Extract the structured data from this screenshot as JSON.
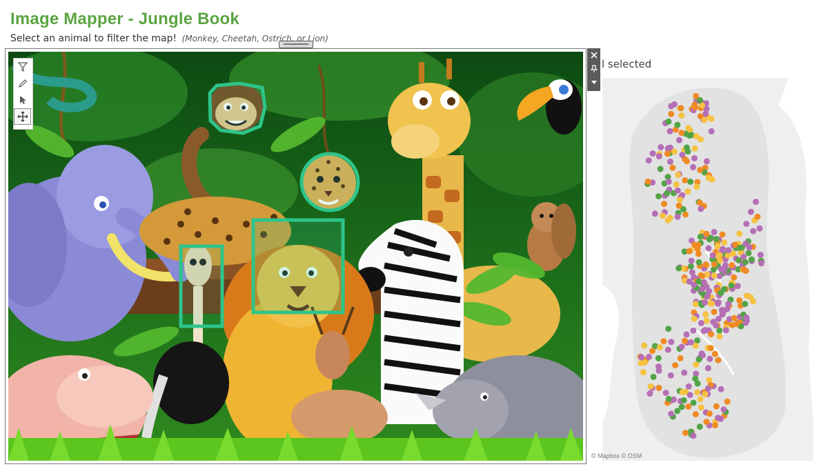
{
  "header": {
    "title": "Image Mapper - Jungle Book",
    "subtitle": "Select an animal to filter the map!",
    "hint": "(Monkey, Cheetah, Ostrich, or Lion)"
  },
  "filter": {
    "status": "l selected"
  },
  "toolbar": {
    "tools": [
      "filter-icon",
      "pencil-icon",
      "pointer-icon",
      "pan-icon"
    ],
    "active_tool": "pan-icon"
  },
  "floating_controls": [
    "close-icon",
    "pin-icon",
    "chevron-down-icon"
  ],
  "hotspots": [
    "Monkey",
    "Cheetah",
    "Ostrich",
    "Lion"
  ],
  "colors": {
    "title": "#5aa442",
    "hotspot_outline": "#2ec48a",
    "map_purple": "#b56fb5",
    "map_orange": "#f08a24",
    "map_yellow": "#f5c242",
    "map_green": "#52a447"
  },
  "map": {
    "attribution": "© Mapbox © OSM"
  }
}
